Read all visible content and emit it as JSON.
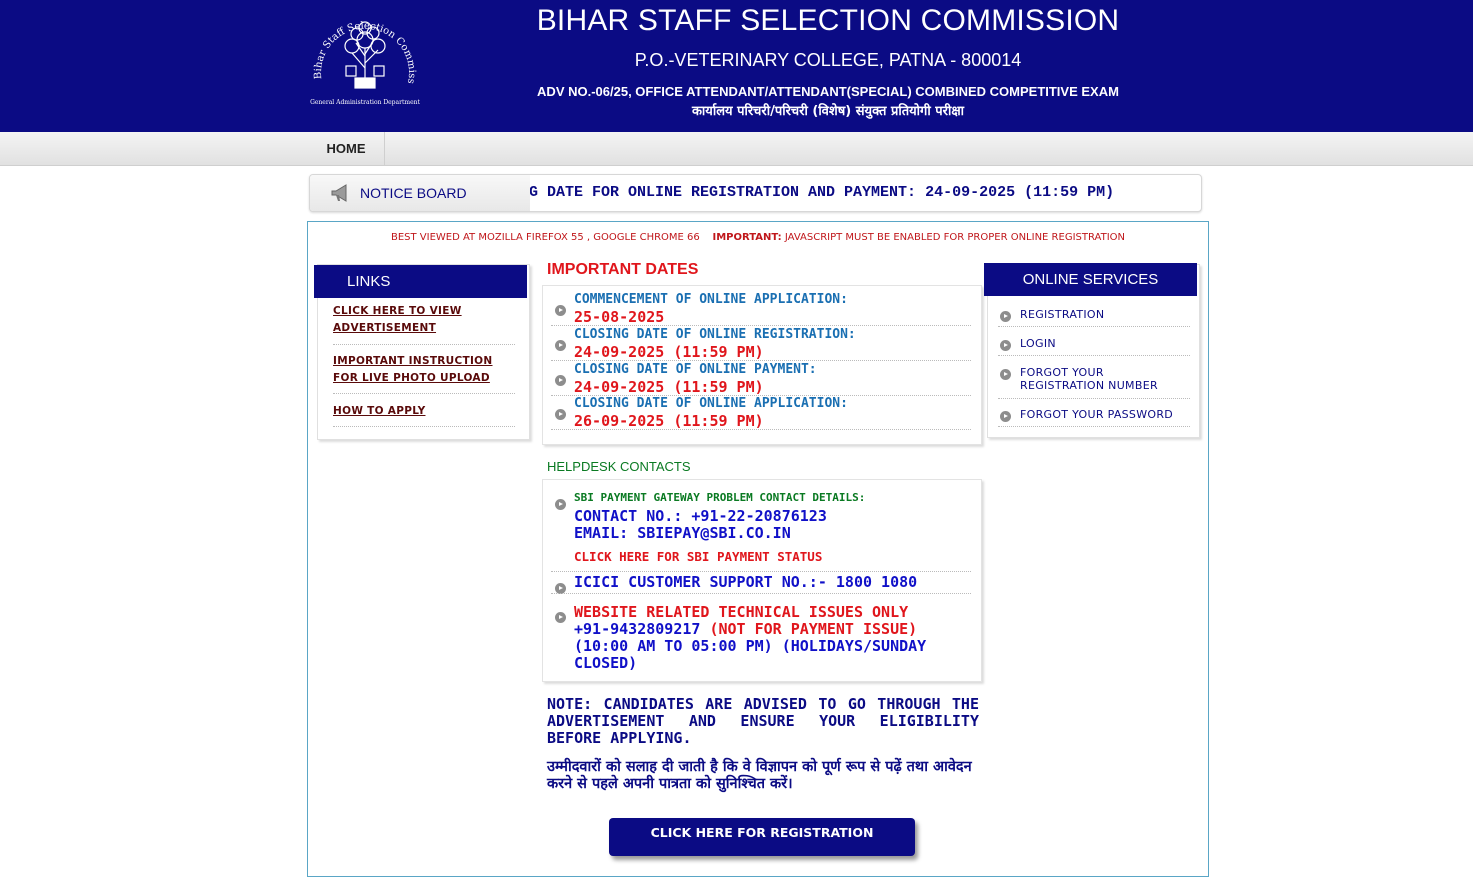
{
  "header": {
    "logo_text": "Bihar Staff Selection Commission, Patna",
    "logo_subtext": "General Administration Department",
    "title": "BIHAR STAFF SELECTION COMMISSION",
    "address": "P.O.-VETERINARY COLLEGE, PATNA - 800014",
    "adv": "ADV NO.-06/25, OFFICE ATTENDANT/ATTENDANT(SPECIAL) COMBINED COMPETITIVE EXAM",
    "adv_hindi": "कार्यालय परिचरी/परिचरी (विशेष) संयुक्त प्रतियोगी परीक्षा",
    "brand_color": "#0b0b84"
  },
  "nav": {
    "home": "HOME"
  },
  "notice_board": {
    "label": "NOTICE BOARD",
    "icon": "megaphone-icon",
    "marquee": "G DATE FOR ONLINE REGISTRATION AND PAYMENT: 24-09-2025 (11:59 PM)"
  },
  "browser_note": {
    "text": "BEST VIEWED AT MOZILLA FIREFOX 55 , GOOGLE CHROME 66",
    "important_label": "IMPORTANT:",
    "important_text": "JAVASCRIPT MUST BE ENABLED FOR PROPER ONLINE REGISTRATION"
  },
  "links": {
    "title": "LINKS",
    "items": [
      {
        "line1": "CLICK HERE TO VIEW",
        "line2": "ADVERTISEMENT"
      },
      {
        "line1": "IMPORTANT INSTRUCTION",
        "line2": "FOR LIVE PHOTO UPLOAD"
      },
      {
        "line1": "HOW TO APPLY",
        "line2": ""
      }
    ]
  },
  "important_dates": {
    "title": "IMPORTANT DATES",
    "items": [
      {
        "label": "COMMENCEMENT OF ONLINE APPLICATION:",
        "value": "25-08-2025"
      },
      {
        "label": "CLOSING DATE OF ONLINE REGISTRATION:",
        "value": "24-09-2025 (11:59 PM)"
      },
      {
        "label": "CLOSING DATE OF ONLINE PAYMENT:",
        "value": "24-09-2025 (11:59 PM)"
      },
      {
        "label": "CLOSING DATE OF ONLINE APPLICATION:",
        "value": "26-09-2025 (11:59 PM)"
      }
    ]
  },
  "helpdesk": {
    "title": "HELPDESK CONTACTS",
    "sbi_title": "SBI PAYMENT GATEWAY PROBLEM CONTACT DETAILS:",
    "sbi_contact": "CONTACT NO.: +91-22-20876123",
    "sbi_email": "EMAIL: SBIEPAY@SBI.CO.IN",
    "sbi_status_link": "CLICK HERE FOR SBI PAYMENT STATUS",
    "icici": "ICICI CUSTOMER SUPPORT NO.:- 1800 1080",
    "tech_title": "WEBSITE RELATED TECHNICAL ISSUES ONLY",
    "tech_phone": "+91-9432809217",
    "tech_note": "(NOT FOR PAYMENT ISSUE)",
    "tech_hours_1": "(10:00 AM TO 05:00 PM) (HOLIDAYS/SUNDAY",
    "tech_hours_2": "CLOSED)"
  },
  "note": {
    "english": "NOTE: CANDIDATES ARE ADVISED TO GO THROUGH THE ADVERTISEMENT AND ENSURE YOUR ELIGIBILITY BEFORE APPLYING.",
    "hindi": "उम्मीदवारों को सलाह दी जाती है कि वे विज्ञापन को पूर्ण रूप से पढ़ें तथा आवेदन करने से पहले अपनी पात्रता को सुनिश्चित करें।"
  },
  "register_button": "CLICK HERE FOR REGISTRATION",
  "online_services": {
    "title": "ONLINE SERVICES",
    "items": [
      {
        "line1": "REGISTRATION",
        "line2": ""
      },
      {
        "line1": "LOGIN",
        "line2": ""
      },
      {
        "line1": "FORGOT YOUR",
        "line2": "REGISTRATION NUMBER"
      },
      {
        "line1": "FORGOT YOUR PASSWORD",
        "line2": ""
      }
    ]
  }
}
